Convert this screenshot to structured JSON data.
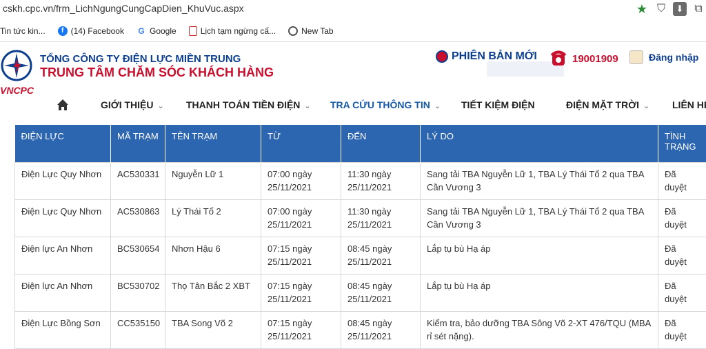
{
  "browser": {
    "url": "cskh.cpc.vn/frm_LichNgungCungCapDien_KhuVuc.aspx",
    "bookmarks": [
      {
        "label": "Tin tức kin...",
        "icon": "none"
      },
      {
        "label": "(14) Facebook",
        "icon": "facebook-icon"
      },
      {
        "label": "Google",
        "icon": "google-icon"
      },
      {
        "label": "Lịch tạm ngừng cấ...",
        "icon": "page-icon"
      },
      {
        "label": "New Tab",
        "icon": "globe-icon"
      }
    ]
  },
  "header": {
    "brand": "VNCPC",
    "company_line1": "TỔNG CÔNG TY ĐIỆN LỰC MIỀN TRUNG",
    "company_line2": "TRUNG TÂM CHĂM SÓC KHÁCH HÀNG",
    "new_version": "PHIÊN BẢN MỚI",
    "hotline": "19001909",
    "login": "Đăng nhập"
  },
  "nav": {
    "items": [
      {
        "label": "GIỚI THIỆU"
      },
      {
        "label": "THANH TOÁN TIỀN ĐIỆN"
      },
      {
        "label": "TRA CỨU THÔNG TIN"
      },
      {
        "label": "TIẾT KIỆM ĐIỆN"
      },
      {
        "label": "ĐIỆN MẶT TRỜI"
      },
      {
        "label": "LIÊN HỆ"
      }
    ]
  },
  "table": {
    "headers": [
      "ĐIỆN LỰC",
      "MÃ TRẠM",
      "TÊN TRẠM",
      "TỪ",
      "ĐẾN",
      "LÝ DO",
      "TÌNH TRẠNG"
    ],
    "rows": [
      [
        "Điện Lực Quy Nhơn",
        "AC530331",
        "Nguyễn Lữ 1",
        "07:00 ngày 25/11/2021",
        "11:30 ngày 25/11/2021",
        "Sang tải TBA Nguyễn Lữ 1, TBA Lý Thái Tổ 2 qua TBA Cần Vương 3",
        "Đã duyệt"
      ],
      [
        "Điện Lực Quy Nhơn",
        "AC530863",
        "Lý Thái Tổ 2",
        "07:00 ngày 25/11/2021",
        "11:30 ngày 25/11/2021",
        "Sang tải TBA Nguyễn Lữ 1, TBA Lý Thái Tổ 2 qua TBA Cần Vương 3",
        "Đã duyệt"
      ],
      [
        "Điện lực An Nhơn",
        "BC530654",
        "Nhơn Hậu 6",
        "07:15 ngày 25/11/2021",
        "08:45 ngày 25/11/2021",
        "Lắp tụ bù Hạ áp",
        "Đã duyệt"
      ],
      [
        "Điện lực An Nhơn",
        "BC530702",
        "Thọ Tân Bắc 2 XBT",
        "07:15 ngày 25/11/2021",
        "08:45 ngày 25/11/2021",
        "Lắp tụ bù Hạ áp",
        "Đã duyệt"
      ],
      [
        "Điện Lực Bồng Sơn",
        "CC535150",
        "TBA Song Võ 2",
        "07:15 ngày 25/11/2021",
        "08:45 ngày 25/11/2021",
        "Kiểm tra, bảo dưỡng TBA Sông Võ 2-XT 476/TQU (MBA rỉ sét nặng).",
        "Đã duyệt"
      ]
    ]
  }
}
